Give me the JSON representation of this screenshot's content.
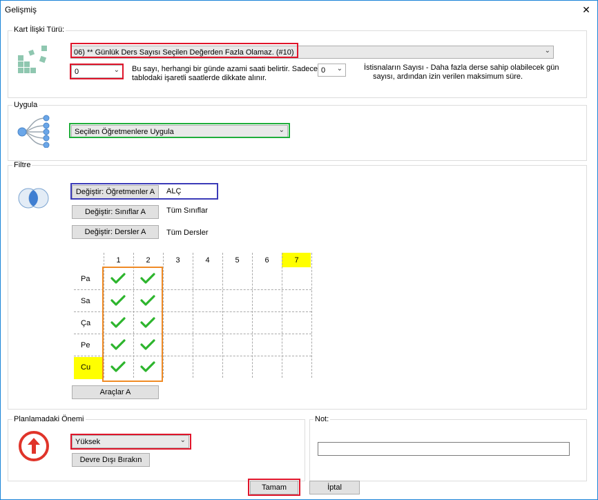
{
  "window": {
    "title": "Gelişmiş",
    "close_symbol": "✕"
  },
  "kart": {
    "legend": "Kart İlişki Türü:",
    "rule_value": "06) ** Günlük Ders Sayısı Seçilen Değerden Fazla Olamaz. (#10)",
    "count_value": "0",
    "description": [
      "Bu sayı, herhangi bir günde azami saati belirtir. Sadece",
      "tablodaki işaretli saatlerde dikkate alınır."
    ],
    "exception_value": "0",
    "exception_text": [
      "İstisnaların Sayısı - Daha fazla derse sahip olabilecek gün",
      "sayısı, ardından izin verilen maksimum süre."
    ]
  },
  "uygula": {
    "legend": "Uygula",
    "value": "Seçilen Öğretmenlere Uygula"
  },
  "filtre": {
    "legend": "Filtre",
    "rows": [
      {
        "button": "Değiştir: Öğretmenler A",
        "value": "ALÇ"
      },
      {
        "button": "Değiştir: Sınıflar A",
        "value": "Tüm Sınıflar"
      },
      {
        "button": "Değiştir: Dersler A",
        "value": "Tüm Dersler"
      }
    ],
    "periods": [
      "1",
      "2",
      "3",
      "4",
      "5",
      "6",
      "7"
    ],
    "days": [
      "Pa",
      "Sa",
      "Ça",
      "Pe",
      "Cu"
    ],
    "checked_periods": [
      "1",
      "2"
    ],
    "highlight_color": "#ffff00",
    "check_color": "#2db52d",
    "tools_button": "Araçlar A"
  },
  "onem": {
    "legend": "Planlamadaki Önemi",
    "value": "Yüksek",
    "disable_button": "Devre Dışı Bırakın",
    "icon_color": "#e0342a"
  },
  "not": {
    "legend": "Not:",
    "value": ""
  },
  "footer": {
    "ok": "Tamam",
    "cancel": "İptal"
  }
}
